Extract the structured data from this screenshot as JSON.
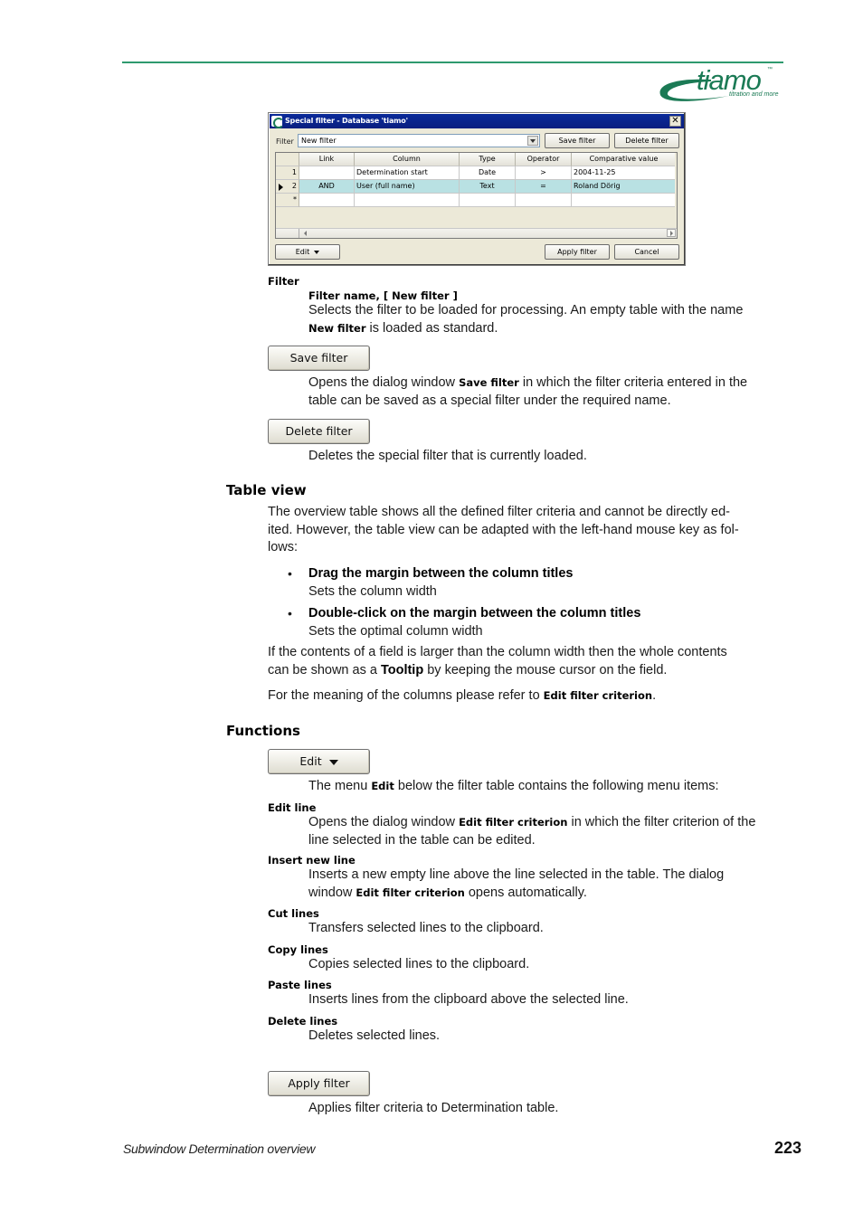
{
  "header": {
    "logo_word": "tiamo",
    "logo_tm": "™",
    "logo_tagline": "titration and more",
    "brand_color": "#1b7a55"
  },
  "dialog": {
    "title": "Special filter - Database 'tiamo'",
    "close_label": "✕",
    "filter_label": "Filter",
    "filter_value": "New filter",
    "save_filter": "Save filter",
    "delete_filter": "Delete filter",
    "columns": [
      "Link",
      "Column",
      "Type",
      "Operator",
      "Comparative value"
    ],
    "rows": [
      {
        "num": "1",
        "link": "",
        "column": "Determination start",
        "type": "Date",
        "operator": ">",
        "value": "2004-11-25",
        "selected": false
      },
      {
        "num": "2",
        "link": "AND",
        "column": "User (full name)",
        "type": "Text",
        "operator": "=",
        "value": "Roland Dörig",
        "selected": true
      }
    ],
    "new_row_marker": "*",
    "edit_button": "Edit",
    "apply_button": "Apply filter",
    "cancel_button": "Cancel",
    "selected_row_color": "#b9e1e3"
  },
  "doc": {
    "filter_heading": "Filter",
    "filter_name_label": "Filter name, [ New filter ]",
    "filter_name_desc_1": "Selects the filter to be loaded for processing. An empty table with the name",
    "filter_name_desc_2a": "New filter",
    "filter_name_desc_2b": " is loaded as standard.",
    "save_btn": "Save filter",
    "save_desc_1a": "Opens the dialog window ",
    "save_desc_1b": "Save filter",
    "save_desc_1c": " in which the filter criteria entered in the",
    "save_desc_2": "table can be saved as a special filter under the required name.",
    "delete_btn": "Delete filter",
    "delete_desc": "Deletes the special filter that is currently loaded.",
    "table_view_heading": "Table view",
    "table_view_p1": "The overview table shows all the defined filter criteria and cannot be directly ed-",
    "table_view_p2": "ited. However, the table view can be adapted with the left-hand mouse key as fol-",
    "table_view_p3": "lows:",
    "bullets": [
      {
        "title": "Drag the margin between the column titles",
        "desc": "Sets the column width"
      },
      {
        "title": "Double-click on the margin between the column titles",
        "desc": "Sets the optimal column width"
      }
    ],
    "tooltip_p1": "If the contents of a field is larger than the column width then the whole contents",
    "tooltip_p2a": "can be shown as a ",
    "tooltip_p2b": "Tooltip",
    "tooltip_p2c": " by keeping the mouse cursor on the field.",
    "meaning_a": "For the meaning of the columns please refer to ",
    "meaning_b": "Edit filter criterion",
    "meaning_c": ".",
    "functions_heading": "Functions",
    "edit_btn": "Edit",
    "menu_intro_a": "The menu ",
    "menu_intro_b": "Edit",
    "menu_intro_c": " below the filter table contains the following menu items:",
    "menu_items": [
      {
        "label": "Edit line",
        "desc_1a": "Opens the dialog window ",
        "desc_1b": "Edit filter criterion",
        "desc_1c": " in which the filter criterion of the",
        "desc_2": "line selected in the table can be edited."
      },
      {
        "label": "Insert new line",
        "desc_1a": "Inserts a new empty line above the line selected in the table. The dialog",
        "desc_2a": "window ",
        "desc_2b": "Edit filter criterion",
        "desc_2c": " opens automatically."
      },
      {
        "label": "Cut lines",
        "desc": "Transfers selected lines to the clipboard."
      },
      {
        "label": "Copy lines",
        "desc": "Copies selected lines to the clipboard."
      },
      {
        "label": "Paste lines",
        "desc": "Inserts lines from the clipboard above the selected line."
      },
      {
        "label": "Delete lines",
        "desc": "Deletes selected lines."
      }
    ],
    "apply_btn": "Apply filter",
    "apply_desc": "Applies filter criteria to Determination table."
  },
  "footer": {
    "section": "Subwindow Determination overview",
    "page_number": "223"
  }
}
